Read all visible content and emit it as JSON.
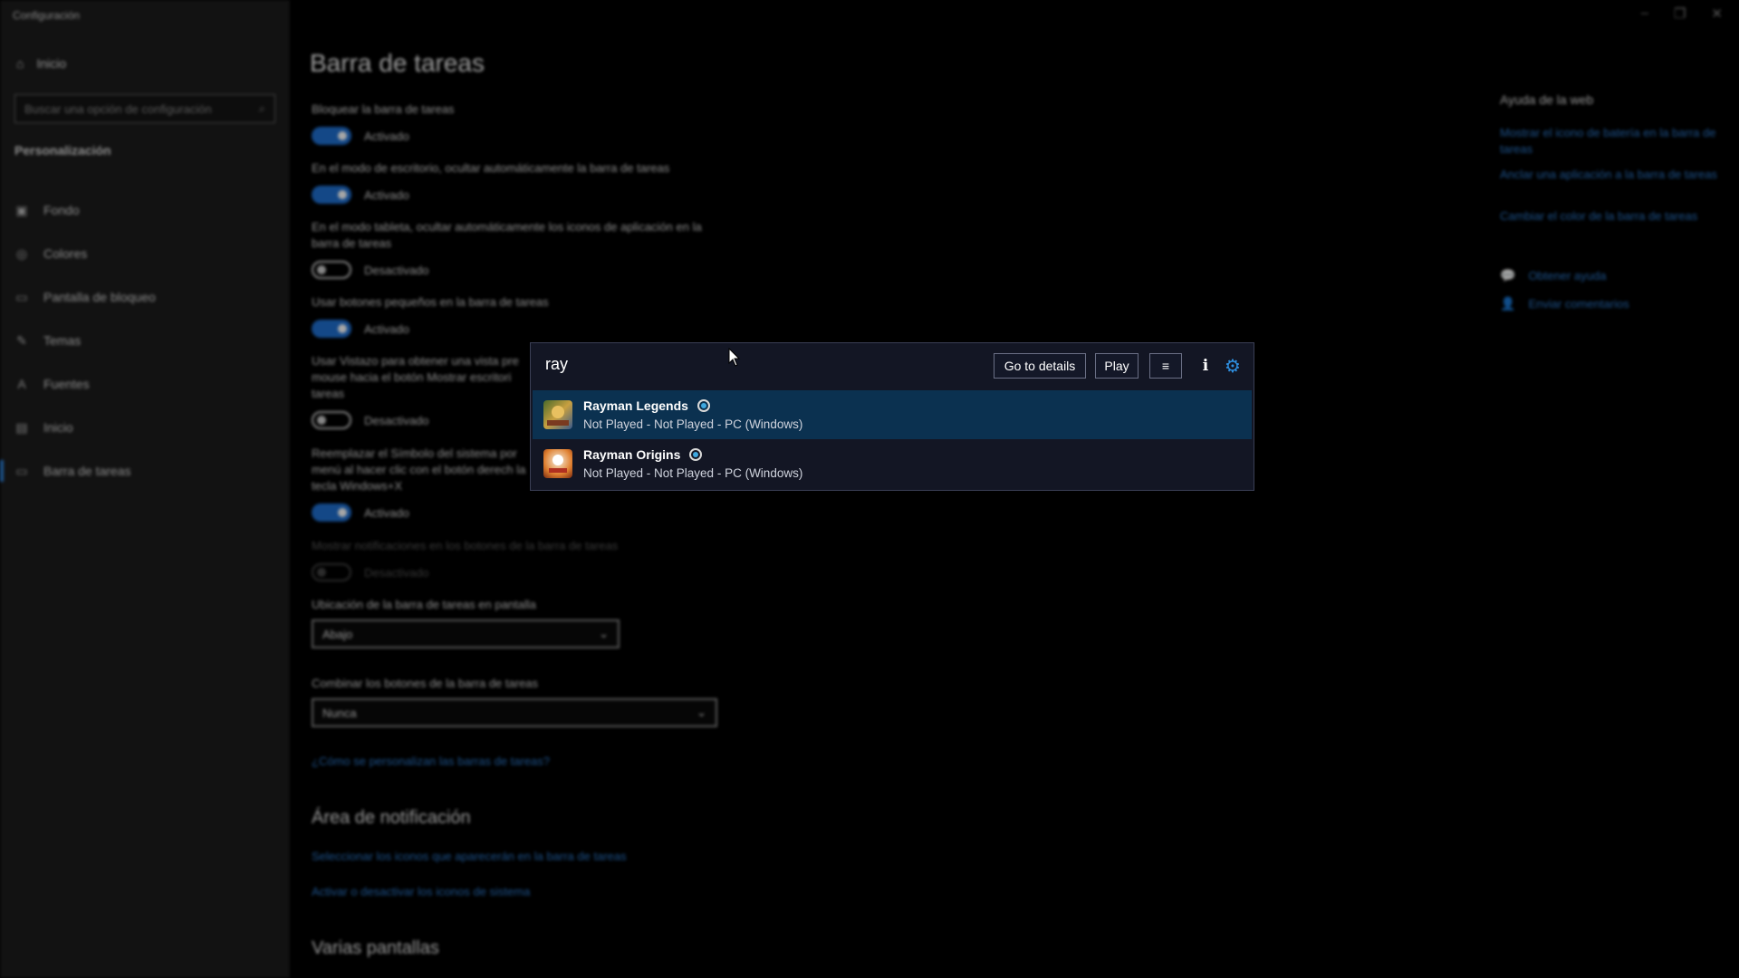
{
  "window": {
    "title": "Configuración",
    "minimize": "–",
    "restore": "❐",
    "close": "✕"
  },
  "sidebar": {
    "home": "Inicio",
    "search_placeholder": "Buscar una opción de configuración",
    "section": "Personalización",
    "items": [
      {
        "label": "Fondo",
        "icon": "image-icon"
      },
      {
        "label": "Colores",
        "icon": "palette-icon"
      },
      {
        "label": "Pantalla de bloqueo",
        "icon": "lock-screen-icon"
      },
      {
        "label": "Temas",
        "icon": "brush-icon"
      },
      {
        "label": "Fuentes",
        "icon": "font-icon"
      },
      {
        "label": "Inicio",
        "icon": "start-icon"
      },
      {
        "label": "Barra de tareas",
        "icon": "taskbar-icon"
      }
    ]
  },
  "main": {
    "title": "Barra de tareas",
    "settings": [
      {
        "label": "Bloquear la barra de tareas",
        "state": "Activado"
      },
      {
        "label": "En el modo de escritorio, ocultar automáticamente la barra de tareas",
        "state": "Activado"
      },
      {
        "label": "En el modo tableta, ocultar automáticamente los iconos de aplicación en la barra de tareas",
        "state": "Desactivado"
      },
      {
        "label": "Usar botones pequeños en la barra de tareas",
        "state": "Activado"
      },
      {
        "label": "Usar Vistazo para obtener una vista pre mouse hacia el botón Mostrar escritori tareas",
        "state": "Desactivado"
      },
      {
        "label": "Reemplazar el Símbolo del sistema por menú al hacer clic con el botón derech la tecla Windows+X",
        "state": "Activado"
      },
      {
        "label": "Mostrar notificaciones en los botones de la barra de tareas",
        "state": "Desactivado"
      }
    ],
    "location_label": "Ubicación de la barra de tareas en pantalla",
    "location_value": "Abajo",
    "combine_label": "Combinar los botones de la barra de tareas",
    "combine_value": "Nunca",
    "customize_link": "¿Cómo se personalizan las barras de tareas?",
    "notif_heading": "Área de notificación",
    "notif_link1": "Seleccionar los iconos que aparecerán en la barra de tareas",
    "notif_link2": "Activar o desactivar los iconos de sistema",
    "multi_heading": "Varias pantallas"
  },
  "help": {
    "title": "Ayuda de la web",
    "links": [
      "Mostrar el icono de batería en la barra de tareas",
      "Anclar una aplicación a la barra de tareas",
      "Cambiar el color de la barra de tareas"
    ],
    "get_help": "Obtener ayuda",
    "feedback": "Enviar comentarios"
  },
  "popup": {
    "query": "ray",
    "go_to_details": "Go to details",
    "play": "Play",
    "results": [
      {
        "name": "Rayman Legends",
        "status": "Not Played - Not Played - PC (Windows)",
        "selected": true
      },
      {
        "name": "Rayman Origins",
        "status": "Not Played - Not Played - PC (Windows)",
        "selected": false
      }
    ]
  },
  "colors": {
    "accent": "#1f6fd0",
    "popup_bg": "#131624",
    "selected_row": "#0b3150",
    "link": "#2e7fd6"
  }
}
